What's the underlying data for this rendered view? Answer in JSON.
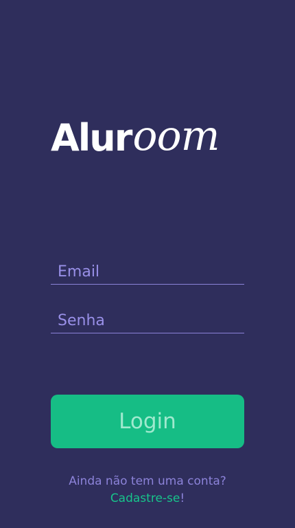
{
  "app": {
    "logo_part_1": "Alur",
    "logo_part_2": "oom"
  },
  "form": {
    "email_placeholder": "Email",
    "password_placeholder": "Senha",
    "login_label": "Login"
  },
  "signup": {
    "question": "Ainda não tem uma conta?",
    "link_label": "Cadastre-se",
    "exclaim": "!"
  },
  "colors": {
    "background": "#2f2e5c",
    "accent": "#16bd85",
    "muted_text": "#8c83d9"
  }
}
